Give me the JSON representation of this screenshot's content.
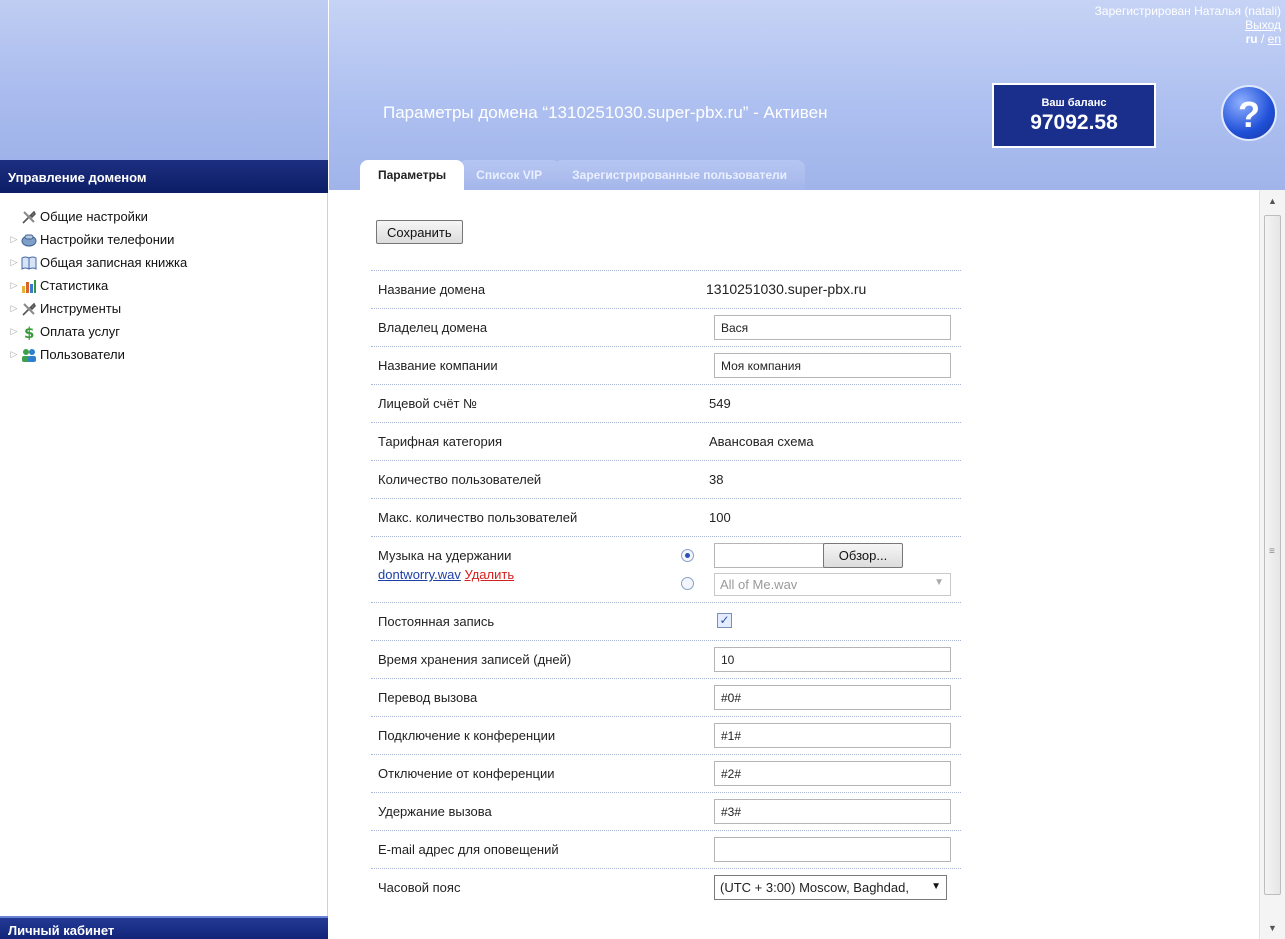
{
  "sidebar": {
    "header": "Управление доменом",
    "items": [
      {
        "label": "Общие настройки",
        "icon": "tools-icon"
      },
      {
        "label": "Настройки телефонии",
        "icon": "phone-settings-icon"
      },
      {
        "label": "Общая записная книжка",
        "icon": "book-icon"
      },
      {
        "label": "Статистика",
        "icon": "chart-icon"
      },
      {
        "label": "Инструменты",
        "icon": "tools-icon"
      },
      {
        "label": "Оплата услуг",
        "icon": "dollar-icon"
      },
      {
        "label": "Пользователи",
        "icon": "users-icon"
      }
    ],
    "footer": "Личный кабинет"
  },
  "header": {
    "user": "Зарегистрирован Наталья (natali)",
    "logout": "Выход",
    "lang_ru": "ru",
    "lang_sep": " / ",
    "lang_en": "en",
    "title": "Параметры домена “1310251030.super-pbx.ru” - Активен",
    "balance_label": "Ваш баланс",
    "balance_value": "97092.58",
    "help": "?"
  },
  "tabs": [
    {
      "label": "Параметры",
      "active": true
    },
    {
      "label": "Список VIP",
      "active": false
    },
    {
      "label": "Зарегистрированные пользователи",
      "active": false
    }
  ],
  "form": {
    "save_label": "Сохранить",
    "domain_name_label": "Название домена",
    "domain_name_value": "1310251030.super-pbx.ru",
    "owner_label": "Владелец домена",
    "owner_value": "Вася",
    "company_label": "Название компании",
    "company_value": "Моя компания",
    "account_label": "Лицевой счёт №",
    "account_value": "549",
    "tariff_label": "Тарифная категория",
    "tariff_value": "Авансовая схема",
    "users_count_label": "Количество пользователей",
    "users_count_value": "38",
    "max_users_label": "Макс. количество пользователей",
    "max_users_value": "100",
    "hold_music_label": "Музыка на удержании",
    "hold_music_file": "dontworry.wav",
    "hold_music_delete": "Удалить",
    "browse_label": "Обзор...",
    "hold_music_select": "All of Me.wav",
    "permanent_record_label": "Постоянная запись",
    "permanent_record_checked": "✓",
    "retention_label": "Время хранения записей (дней)",
    "retention_value": "10",
    "transfer_label": "Перевод вызова",
    "transfer_value": "#0#",
    "conf_join_label": "Подключение к конференции",
    "conf_join_value": "#1#",
    "conf_leave_label": "Отключение от конференции",
    "conf_leave_value": "#2#",
    "hold_label": "Удержание вызова",
    "hold_value": "#3#",
    "email_label": "E-mail адрес для оповещений",
    "email_value": "",
    "timezone_label": "Часовой пояс",
    "timezone_value": "(UTC + 3:00) Moscow, Baghdad,"
  }
}
